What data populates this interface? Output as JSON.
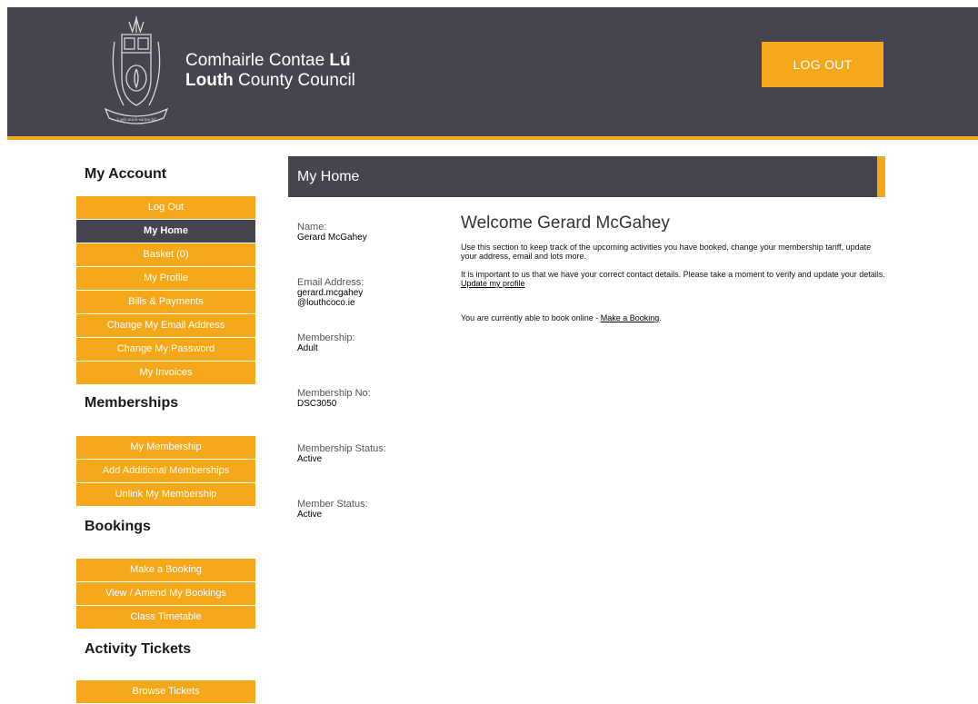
{
  "header": {
    "brand_line1_regular": "Comhairle Contae ",
    "brand_line1_bold": "Lú",
    "brand_line2_bold": "Louth",
    "brand_line2_regular": " County Council",
    "crest_motto": "Lugh seach-saileachd",
    "logout_label": "LOG OUT"
  },
  "colors": {
    "accent": "#f5a81a",
    "dark": "#44454e"
  },
  "sidebar": {
    "account": {
      "heading": "My Account",
      "items": [
        "Log Out",
        "My Home",
        "Basket (0)",
        "My Profile",
        "Bills & Payments",
        "Change My Email Address",
        "Change My Password",
        "My Invoices"
      ],
      "active": "My Home"
    },
    "memberships": {
      "heading": "Memberships",
      "items": [
        "My Membership",
        "Add Additional Memberships",
        "Unlink My Membership"
      ]
    },
    "bookings": {
      "heading": "Bookings",
      "items": [
        "Make a Booking",
        "View / Amend My Bookings",
        "Class Timetable"
      ]
    },
    "tickets": {
      "heading": "Activity Tickets",
      "items": [
        "Browse Tickets"
      ]
    }
  },
  "main": {
    "title": "My Home",
    "profile": [
      {
        "label": "Name:",
        "value": "Gerard McGahey"
      },
      {
        "label": "Email Address:",
        "value": "gerard.mcgahey",
        "value2": "@louthcoco.ie"
      },
      {
        "label": "Membership:",
        "value": "Adult"
      },
      {
        "label": "Membership No:",
        "value": "DSC3050"
      },
      {
        "label": "Membership Status:",
        "value": "Active"
      },
      {
        "label": "Member Status:",
        "value": "Active"
      }
    ],
    "welcome": "Welcome Gerard McGahey",
    "intro": "Use this section to keep track of the upcoming activities you have booked, change your membership tariff, update your address, email and lots more.",
    "contact_text": "It is important to us that we have your correct contact details. Please take a moment to verify and update your details. ",
    "contact_link": "Update my profile",
    "booking_text": "You are currently able to book online - ",
    "booking_link": "Make a Booking",
    "booking_end": "."
  }
}
